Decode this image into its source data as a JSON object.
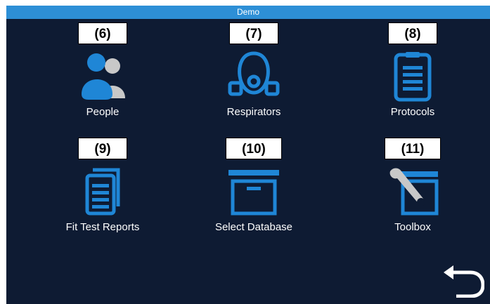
{
  "window": {
    "title": "Demo"
  },
  "tiles": [
    {
      "tag": "(6)",
      "label": "People",
      "icon": "people-icon"
    },
    {
      "tag": "(7)",
      "label": "Respirators",
      "icon": "respirator-mask-icon"
    },
    {
      "tag": "(8)",
      "label": "Protocols",
      "icon": "clipboard-icon"
    },
    {
      "tag": "(9)",
      "label": "Fit Test Reports",
      "icon": "documents-icon"
    },
    {
      "tag": "(10)",
      "label": "Select Database",
      "icon": "archive-box-icon"
    },
    {
      "tag": "(11)",
      "label": "Toolbox",
      "icon": "toolbox-icon"
    }
  ],
  "colors": {
    "accent": "#2d8fd6",
    "icon": "#1f86d6",
    "background": "#0e1b33",
    "gray": "#c8c8c8"
  },
  "back_button": {
    "icon": "back-arrow-icon"
  }
}
